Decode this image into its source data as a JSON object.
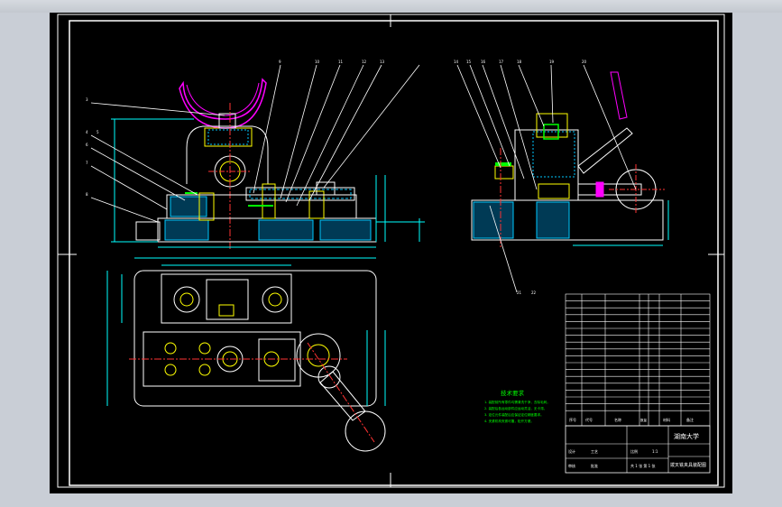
{
  "app": {
    "viewport_bg": "#000000",
    "frame_bg": "#c9ced6"
  },
  "colors": {
    "outline": "#ffffff",
    "dimension": "#00ffff",
    "hatch": "#00c8ff",
    "leader": "#ffffff",
    "part_white": "#ffffff",
    "workpiece": "#ff00ff",
    "bolts": "#ffff00",
    "center_lines": "#ff3333",
    "green_parts": "#00ff00",
    "tech_notes": "#00ff00",
    "titleblock": "#ffffff"
  },
  "tech_requirements": {
    "title": "技术要求",
    "items": [
      "1. 装配前所有零件均需清洗干净，去除毛刺。",
      "2. 装配后各运动部件应运动灵活，无卡滞。",
      "3. 定位元件装配后应保证定位精度要求。",
      "4. 夹紧机构夹紧可靠，松开方便。"
    ]
  },
  "titleblock": {
    "school": "湖南大学",
    "drawing_name": "拨叉铣夹具装配图",
    "header_labels": [
      "序号",
      "代号",
      "名称",
      "数量",
      "材料",
      "备注"
    ],
    "sign_labels": [
      "设计",
      "审核",
      "工艺",
      "批准"
    ],
    "scale_label": "比例",
    "scale_value": "1:1",
    "sheet_label": "共 1 张 第 1 张"
  },
  "balloons_front": [
    "3",
    "4",
    "5",
    "6",
    "7",
    "8",
    "9",
    "10",
    "11",
    "12",
    "13"
  ],
  "balloons_side": [
    "14",
    "15",
    "16",
    "17",
    "18",
    "19",
    "20"
  ],
  "balloons_lower": [
    "21",
    "22"
  ]
}
